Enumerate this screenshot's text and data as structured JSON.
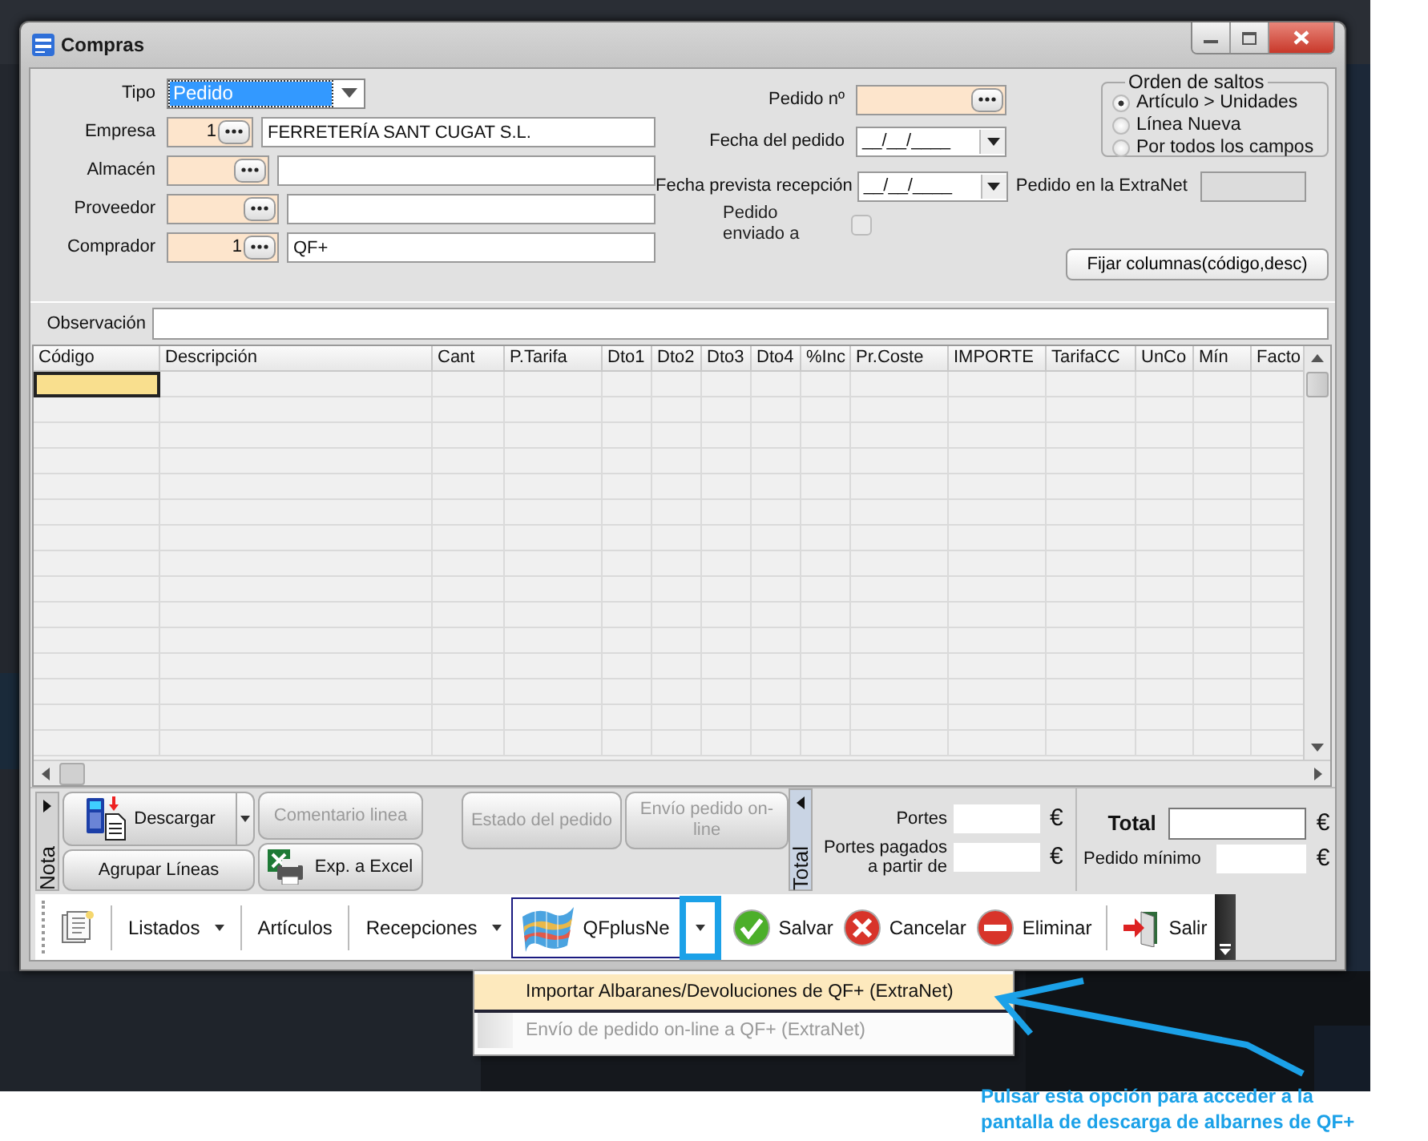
{
  "window": {
    "title": "Compras"
  },
  "header_fields": [
    {
      "kind": "select",
      "label": "Tipo",
      "value": "Pedido"
    },
    {
      "kind": "lookup",
      "label": "Empresa",
      "code": "1",
      "name": "FERRETERÍA SANT CUGAT S.L."
    },
    {
      "kind": "lookup",
      "label": "Almacén"
    },
    {
      "kind": "lookup",
      "label": "Proveedor"
    },
    {
      "kind": "lookup",
      "label": "Comprador",
      "code": "1",
      "name": "QF+"
    }
  ],
  "order_fields": [
    {
      "kind": "lookup",
      "label": "Pedido nº"
    },
    {
      "kind": "date",
      "label": "Fecha del pedido",
      "value": "__/__/____"
    },
    {
      "kind": "date",
      "label": "Fecha prevista recepción",
      "value": "__/__/____",
      "extra_label": "Pedido en la ExtraNet"
    },
    {
      "kind": "checkbox",
      "label": "Pedido enviado a",
      "checked": false
    }
  ],
  "jump_order": {
    "title": "Orden de saltos",
    "options": [
      {
        "label": "Artículo > Unidades",
        "selected": true
      },
      {
        "label": "Línea Nueva",
        "selected": false
      },
      {
        "label": "Por todos los campos",
        "selected": false
      }
    ]
  },
  "fix_columns_button": "Fijar columnas(código,desc)",
  "observation": {
    "label": "Observación"
  },
  "table": {
    "columns": [
      "Código",
      "Descripción",
      "Cant",
      "P.Tarifa",
      "Dto1",
      "Dto2",
      "Dto3",
      "Dto4",
      "%Inc",
      "Pr.Coste",
      "IMPORTE",
      "TarifaCC",
      "UnCo",
      "Mín",
      "Facto"
    ],
    "rows": [
      {
        "focused": true
      },
      {
        "focused": false
      },
      {
        "focused": false
      },
      {
        "focused": false
      },
      {
        "focused": false
      },
      {
        "focused": false
      },
      {
        "focused": false
      },
      {
        "focused": false
      },
      {
        "focused": false
      },
      {
        "focused": false
      },
      {
        "focused": false
      },
      {
        "focused": false
      },
      {
        "focused": false
      },
      {
        "focused": false
      },
      {
        "focused": false
      }
    ]
  },
  "line_actions": {
    "tab": "Nota",
    "buttons": [
      {
        "kind": "download",
        "label": "Descargar",
        "disabled": false
      },
      {
        "kind": "plain",
        "label": "Comentario linea",
        "disabled": true
      },
      {
        "kind": "plain",
        "label": "Estado del pedido",
        "disabled": true
      },
      {
        "kind": "plain",
        "label": "Envío pedido on-line",
        "disabled": true
      },
      {
        "kind": "plain",
        "label": "Agrupar Líneas",
        "disabled": false
      },
      {
        "kind": "excel",
        "label": "Exp. a Excel",
        "disabled": false
      }
    ]
  },
  "totals": {
    "tab": "Total",
    "shipping": {
      "label": "Portes",
      "currency": "€"
    },
    "free_shipping": {
      "label": "Portes pagados a partir de",
      "currency": "€"
    },
    "total": {
      "label": "Total",
      "currency": "€"
    },
    "minimum_order": {
      "label": "Pedido mínimo",
      "currency": "€"
    }
  },
  "toolbar": {
    "items": [
      {
        "kind": "notes"
      },
      {
        "kind": "menu",
        "label": "Listados"
      },
      {
        "kind": "link",
        "label": "Artículos"
      },
      {
        "kind": "menu",
        "label": "Recepciones"
      },
      {
        "kind": "split",
        "label": "QFplusNe"
      },
      {
        "kind": "save",
        "label": "Salvar"
      },
      {
        "kind": "cancel",
        "label": "Cancelar"
      },
      {
        "kind": "delete",
        "label": "Eliminar"
      },
      {
        "kind": "exit",
        "label": "Salir"
      }
    ]
  },
  "dropdown_menu": {
    "items": [
      {
        "label": "Importar Albaranes/Devoluciones de QF+ (ExtraNet)",
        "selected": true,
        "disabled": false
      },
      {
        "label": "Envío de pedido on-line a QF+ (ExtraNet)",
        "selected": false,
        "disabled": true
      }
    ]
  },
  "annotation": {
    "text": "Pulsar esta opción para acceder a la pantalla de descarga de albarnes de QF+"
  }
}
